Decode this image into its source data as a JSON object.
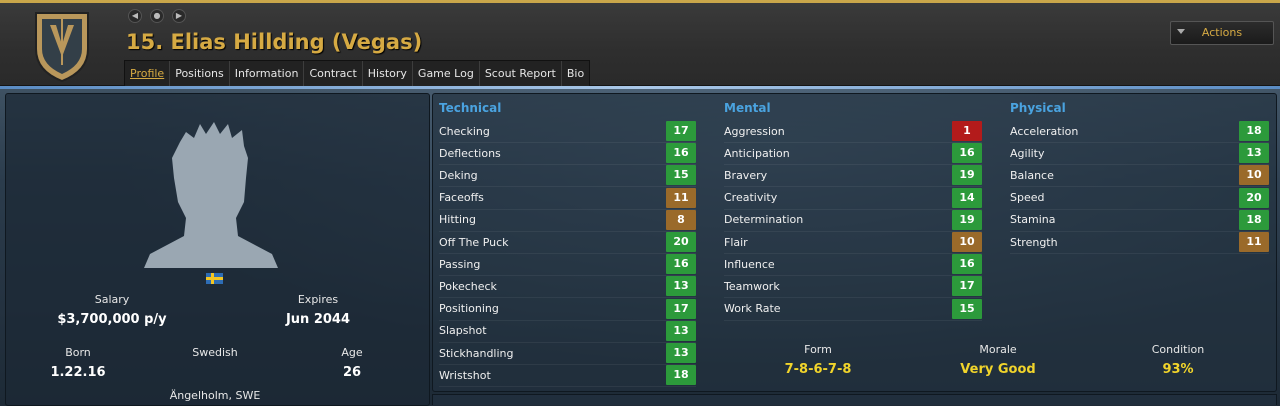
{
  "header": {
    "player_name": "15. Elias Hillding (Vegas)",
    "actions_label": "Actions",
    "tabs": [
      "Profile",
      "Positions",
      "Information",
      "Contract",
      "History",
      "Game Log",
      "Scout Report",
      "Bio"
    ],
    "active_tab": "Profile"
  },
  "profile": {
    "salary_label": "Salary",
    "salary_value": "$3,700,000 p/y",
    "expires_label": "Expires",
    "expires_value": "Jun 2044",
    "born_label": "Born",
    "born_value": "1.22.16",
    "nationality": "Swedish",
    "age_label": "Age",
    "age_value": "26",
    "birthplace": "Ängelholm, SWE"
  },
  "attributes": {
    "technical": {
      "title": "Technical",
      "items": [
        {
          "label": "Checking",
          "value": "17",
          "tone": "green"
        },
        {
          "label": "Deflections",
          "value": "16",
          "tone": "green"
        },
        {
          "label": "Deking",
          "value": "15",
          "tone": "green"
        },
        {
          "label": "Faceoffs",
          "value": "11",
          "tone": "orange"
        },
        {
          "label": "Hitting",
          "value": "8",
          "tone": "orange"
        },
        {
          "label": "Off The Puck",
          "value": "20",
          "tone": "green"
        },
        {
          "label": "Passing",
          "value": "16",
          "tone": "green"
        },
        {
          "label": "Pokecheck",
          "value": "13",
          "tone": "green"
        },
        {
          "label": "Positioning",
          "value": "17",
          "tone": "green"
        },
        {
          "label": "Slapshot",
          "value": "13",
          "tone": "green"
        },
        {
          "label": "Stickhandling",
          "value": "13",
          "tone": "green"
        },
        {
          "label": "Wristshot",
          "value": "18",
          "tone": "green"
        }
      ]
    },
    "mental": {
      "title": "Mental",
      "items": [
        {
          "label": "Aggression",
          "value": "1",
          "tone": "red"
        },
        {
          "label": "Anticipation",
          "value": "16",
          "tone": "green"
        },
        {
          "label": "Bravery",
          "value": "19",
          "tone": "green"
        },
        {
          "label": "Creativity",
          "value": "14",
          "tone": "green"
        },
        {
          "label": "Determination",
          "value": "19",
          "tone": "green"
        },
        {
          "label": "Flair",
          "value": "10",
          "tone": "orange"
        },
        {
          "label": "Influence",
          "value": "16",
          "tone": "green"
        },
        {
          "label": "Teamwork",
          "value": "17",
          "tone": "green"
        },
        {
          "label": "Work Rate",
          "value": "15",
          "tone": "green"
        }
      ]
    },
    "physical": {
      "title": "Physical",
      "items": [
        {
          "label": "Acceleration",
          "value": "18",
          "tone": "green"
        },
        {
          "label": "Agility",
          "value": "13",
          "tone": "green"
        },
        {
          "label": "Balance",
          "value": "10",
          "tone": "orange"
        },
        {
          "label": "Speed",
          "value": "20",
          "tone": "green"
        },
        {
          "label": "Stamina",
          "value": "18",
          "tone": "green"
        },
        {
          "label": "Strength",
          "value": "11",
          "tone": "orange"
        }
      ]
    }
  },
  "summary": {
    "form_label": "Form",
    "form_value": "7-8-6-7-8",
    "morale_label": "Morale",
    "morale_value": "Very Good",
    "condition_label": "Condition",
    "condition_value": "93%"
  },
  "colors": {
    "accent_gold": "#d6aa43",
    "section_blue": "#4aa3e0",
    "high_green": "#2c9a3b",
    "mid_orange": "#9a6a2a",
    "low_red": "#b31b1b",
    "summary_yellow": "#f1d42b"
  },
  "icons": {
    "team_logo": "knight-helmet-shield",
    "back": "back-icon",
    "forward": "forward-icon",
    "home": "home-icon",
    "avatar": "player-silhouette"
  }
}
